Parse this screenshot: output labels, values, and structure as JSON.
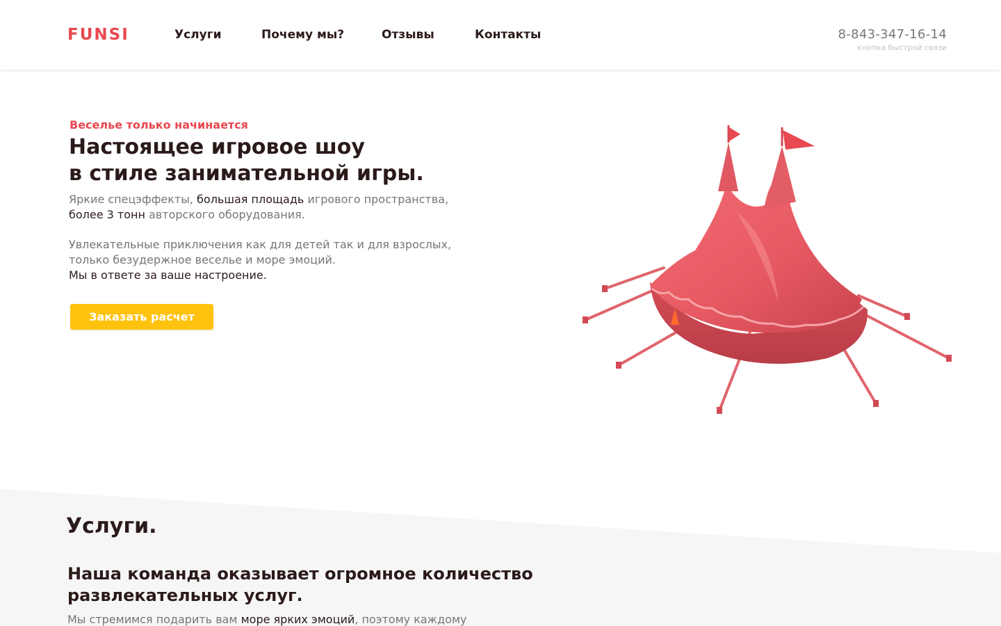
{
  "header": {
    "logo": "FUNSI",
    "nav": [
      {
        "label": "Услуги"
      },
      {
        "label": "Почему мы?"
      },
      {
        "label": "Отзывы"
      },
      {
        "label": "Контакты"
      }
    ],
    "phone": "8-843-347-16-14",
    "phone_hint": "кнопка быстрой связи"
  },
  "hero": {
    "eyebrow": "Веселье только начинается",
    "title_line1": "Настоящее игровое шоу",
    "title_line2": "в стиле занимательной игры.",
    "p1_a": "Яркие спецэффекты, ",
    "p1_b": "большая площадь",
    "p1_c": " игрового пространства,",
    "p1_d": "более 3 тонн",
    "p1_e": " авторского оборудования.",
    "p2_line1": "Увлекательные приключения как для детей так и для взрослых,",
    "p2_line2": "только безудержное веселье и море эмоций.",
    "p2_line3": "Мы в ответе за ваше настроение.",
    "cta_label": "Заказать расчет",
    "image": "circus-tent-illustration"
  },
  "services": {
    "title": "Услуги.",
    "lead_line1": "Наша команда оказывает огромное количество",
    "lead_line2": "развлекательных услуг.",
    "text_a": "Мы стремимся подарить вам ",
    "text_b": "море ярких эмоций",
    "text_c": ", поэтому каждому"
  },
  "colors": {
    "accent": "#e8484f",
    "button": "#ffc20e",
    "heading": "#2b1a1a",
    "muted": "#7a7376",
    "section_bg": "#f6f6f6"
  }
}
